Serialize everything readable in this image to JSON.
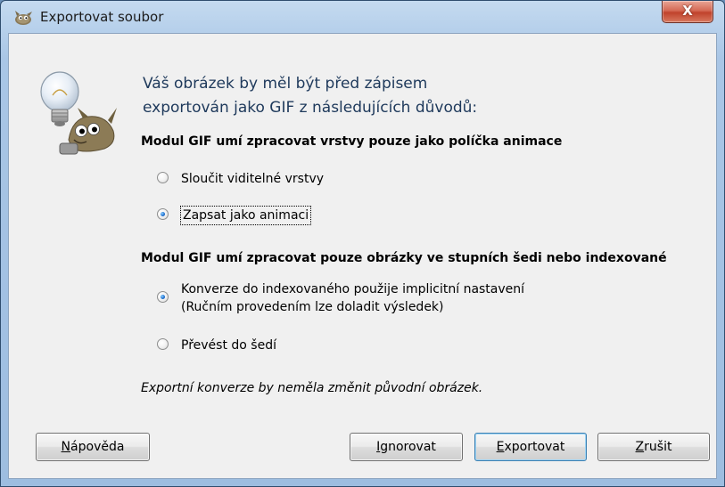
{
  "window": {
    "title": "Exportovat soubor",
    "close_glyph": "X"
  },
  "icons": {
    "app": "gimp-wilber-icon",
    "hint": "lightbulb-wilber-icon",
    "close": "close-icon"
  },
  "intro": {
    "line1": "Váš obrázek by měl být před zápisem",
    "line2": "exportován jako GIF z následujících důvodů:"
  },
  "section1": {
    "title": "Modul GIF umí zpracovat vrstvy pouze jako políčka animace",
    "options": [
      {
        "label": "Sloučit viditelné vrstvy",
        "checked": false
      },
      {
        "label": "Zapsat jako animaci",
        "checked": true
      }
    ]
  },
  "section2": {
    "title": "Modul GIF umí zpracovat pouze obrázky ve stupních šedi nebo indexované",
    "options": [
      {
        "line1": "Konverze do indexovaného použije implicitní nastavení",
        "line2": "(Ručním provedením lze doladit výsledek)",
        "checked": true
      },
      {
        "label": "Převést do šedí",
        "checked": false
      }
    ]
  },
  "note": "Exportní konverze by neměla změnit původní obrázek.",
  "buttons": {
    "help": {
      "mnemonic": "N",
      "rest": "ápověda"
    },
    "ignore": {
      "mnemonic": "I",
      "rest": "gnorovat"
    },
    "export": {
      "mnemonic": "E",
      "rest": "xportovat"
    },
    "cancel": {
      "mnemonic": "Z",
      "rest": "rušit"
    }
  },
  "colors": {
    "intro_text": "#1e395b",
    "radio_selected": "#1c6fcf",
    "close_button": "#c0422c"
  }
}
